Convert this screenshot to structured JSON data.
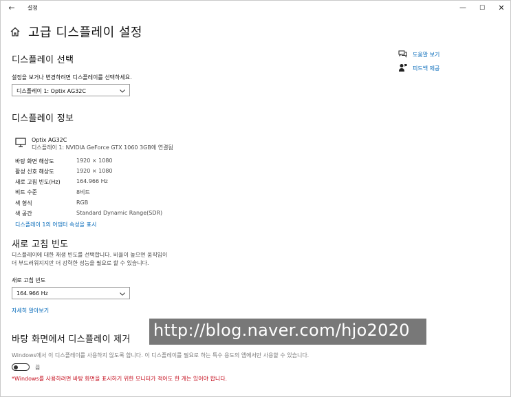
{
  "window": {
    "title": "설정",
    "back_glyph": "←",
    "minimize_glyph": "—",
    "maximize_glyph": "☐",
    "close_glyph": "✕"
  },
  "page": {
    "title": "고급 디스플레이 설정"
  },
  "select_display": {
    "heading": "디스플레이 선택",
    "description": "설정을 보거나 변경하려면 디스플레이를 선택하세요.",
    "selected": "디스플레이 1: Optix AG32C"
  },
  "help": {
    "get_help": "도움말 보기",
    "feedback": "피드백 제공"
  },
  "display_info": {
    "heading": "디스플레이 정보",
    "monitor_name": "Optix AG32C",
    "monitor_sub": "디스플레이 1: NVIDIA GeForce GTX 1060 3GB에 연결됨",
    "rows": [
      {
        "label": "바탕 화면 해상도",
        "value": "1920 × 1080"
      },
      {
        "label": "활성 신호 해상도",
        "value": "1920 × 1080"
      },
      {
        "label": "새로 고침 빈도(Hz)",
        "value": "164.966 Hz"
      },
      {
        "label": "비트 수준",
        "value": "8비트"
      },
      {
        "label": "색 형식",
        "value": "RGB"
      },
      {
        "label": "색 공간",
        "value": "Standard Dynamic Range(SDR)"
      }
    ],
    "adapter_link": "디스플레이 1의 어댑터 속성을 표시"
  },
  "refresh_rate": {
    "heading": "새로 고침 빈도",
    "desc_line1": "디스플레이에 대한 재생 빈도를 선택합니다. 비율이 높으면 움직임이",
    "desc_line2": "더 부드러워지지만 더 강력한 성능을 필요로 할 수 있습니다.",
    "field_label": "새로 고침 빈도",
    "selected": "164.966 Hz",
    "learn_more": "자세히 알아보기"
  },
  "remove_display": {
    "heading": "바탕 화면에서 디스플레이 제거",
    "description": "Windows에서 이 디스플레이를 사용하지 않도록 합니다. 이 디스플레이를 필요로 하는 특수 용도의 앱에서만 사용할 수 있습니다.",
    "toggle_state": "끔",
    "toggle_on": false,
    "warning": "*Windows를 사용하려면 바탕 화면을 표시하기 위한 모니터가 적어도 한 개는 있어야 합니다."
  },
  "watermark": {
    "text": "http://blog.naver.com/hjo2020"
  }
}
